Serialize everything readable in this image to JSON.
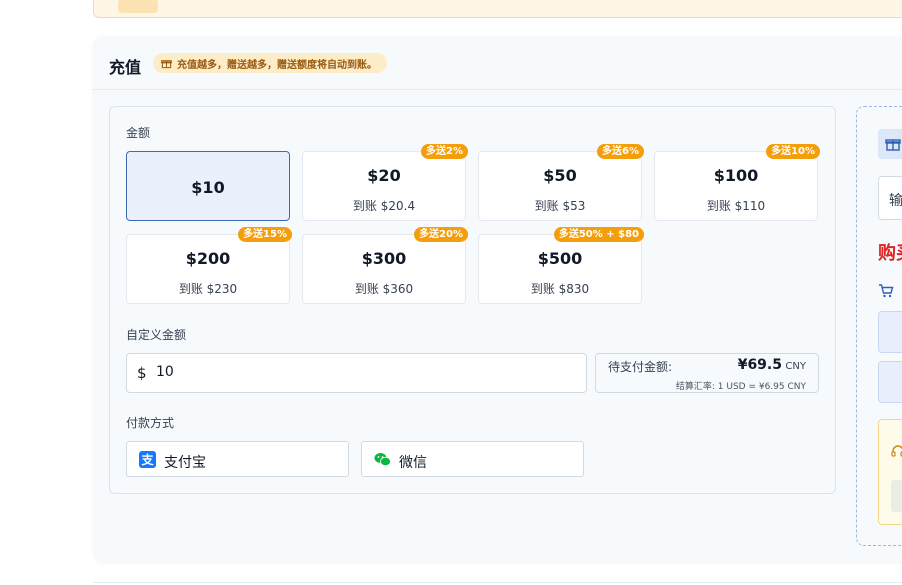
{
  "section": {
    "title": "充值",
    "tip": "充值越多，赠送越多，赠送额度将自动到账。"
  },
  "amount_label": "金额",
  "amounts": [
    {
      "value": "$10",
      "arrive": "",
      "badge": ""
    },
    {
      "value": "$20",
      "arrive": "到账 $20.4",
      "badge": "多送2%"
    },
    {
      "value": "$50",
      "arrive": "到账 $53",
      "badge": "多送6%"
    },
    {
      "value": "$100",
      "arrive": "到账 $110",
      "badge": "多送10%"
    },
    {
      "value": "$200",
      "arrive": "到账 $230",
      "badge": "多送15%"
    },
    {
      "value": "$300",
      "arrive": "到账 $360",
      "badge": "多送20%"
    },
    {
      "value": "$500",
      "arrive": "到账 $830",
      "badge": "多送50% + $80"
    }
  ],
  "custom": {
    "label": "自定义金额",
    "currency_symbol": "$",
    "value": "10"
  },
  "payable": {
    "label": "待支付金额:",
    "amount": "¥69.5",
    "unit": "CNY",
    "rate": "结算汇率: 1 USD = ¥6.95 CNY"
  },
  "payment": {
    "label": "付款方式",
    "methods": [
      {
        "name": "支付宝",
        "icon": "alipay-icon"
      },
      {
        "name": "微信",
        "icon": "wechat-icon"
      }
    ]
  },
  "side": {
    "code_placeholder": "输",
    "buy_title": "购买"
  },
  "colors": {
    "selected_border": "#3c6bb4",
    "selected_bg": "#eaf1fd",
    "badge": "#f59e0b",
    "tip_bg": "#fdecc8",
    "buy_red": "#dc2626",
    "alipay": "#1677ff",
    "wechat": "#09b83e"
  }
}
